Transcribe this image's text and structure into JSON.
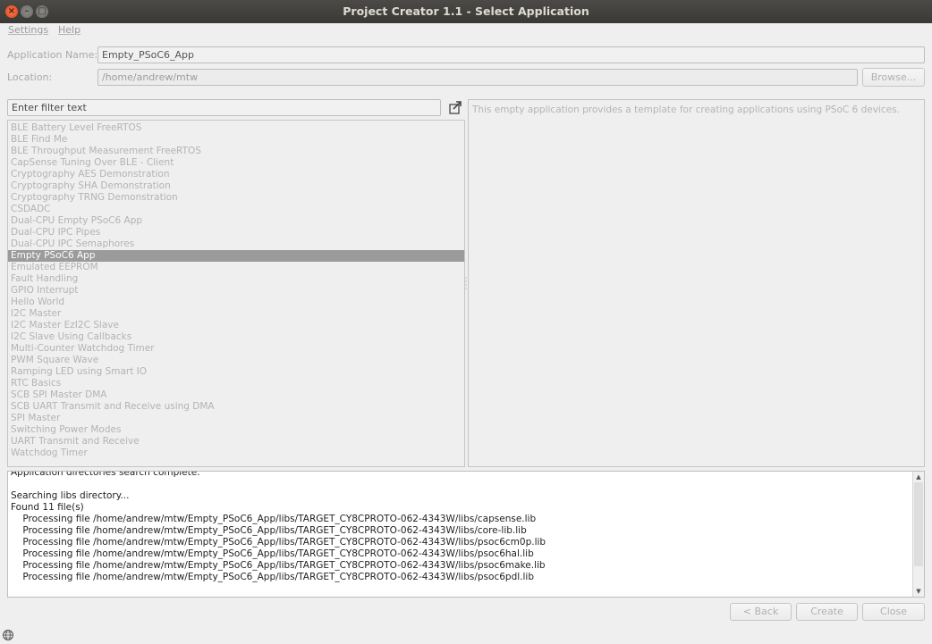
{
  "window": {
    "title": "Project Creator 1.1 - Select Application"
  },
  "menu": {
    "settings": "Settings",
    "help": "Help"
  },
  "form": {
    "app_name_label": "Application Name:",
    "app_name_value": "Empty_PSoC6_App",
    "location_label": "Location:",
    "location_value": "/home/andrew/mtw",
    "browse_label": "Browse..."
  },
  "filter": {
    "placeholder": "Enter filter text"
  },
  "apps": [
    {
      "label": "BLE Battery Level FreeRTOS",
      "selected": false
    },
    {
      "label": "BLE Find Me",
      "selected": false
    },
    {
      "label": "BLE Throughput Measurement FreeRTOS",
      "selected": false
    },
    {
      "label": "CapSense Tuning Over BLE - Client",
      "selected": false
    },
    {
      "label": "Cryptography AES Demonstration",
      "selected": false
    },
    {
      "label": "Cryptography SHA Demonstration",
      "selected": false
    },
    {
      "label": "Cryptography TRNG Demonstration",
      "selected": false
    },
    {
      "label": "CSDADC",
      "selected": false
    },
    {
      "label": "Dual-CPU Empty PSoC6 App",
      "selected": false
    },
    {
      "label": "Dual-CPU IPC Pipes",
      "selected": false
    },
    {
      "label": "Dual-CPU IPC Semaphores",
      "selected": false
    },
    {
      "label": "Empty PSoC6 App",
      "selected": true
    },
    {
      "label": "Emulated EEPROM",
      "selected": false
    },
    {
      "label": "Fault Handling",
      "selected": false
    },
    {
      "label": "GPIO Interrupt",
      "selected": false
    },
    {
      "label": "Hello World",
      "selected": false
    },
    {
      "label": "I2C Master",
      "selected": false
    },
    {
      "label": "I2C Master EzI2C Slave",
      "selected": false
    },
    {
      "label": "I2C Slave Using Callbacks",
      "selected": false
    },
    {
      "label": "Multi-Counter Watchdog Timer",
      "selected": false
    },
    {
      "label": "PWM Square Wave",
      "selected": false
    },
    {
      "label": "Ramping LED using Smart IO",
      "selected": false
    },
    {
      "label": "RTC Basics",
      "selected": false
    },
    {
      "label": "SCB SPI Master DMA",
      "selected": false
    },
    {
      "label": "SCB UART Transmit and Receive using DMA",
      "selected": false
    },
    {
      "label": "SPI Master",
      "selected": false
    },
    {
      "label": "Switching Power Modes",
      "selected": false
    },
    {
      "label": "UART Transmit and Receive",
      "selected": false
    },
    {
      "label": "Watchdog Timer",
      "selected": false
    }
  ],
  "description": "This empty application provides a template for creating applications using PSoC 6 devices.",
  "log": [
    "Application directories search complete.",
    "",
    "Searching libs directory...",
    "Found 11 file(s)",
    "    Processing file /home/andrew/mtw/Empty_PSoC6_App/libs/TARGET_CY8CPROTO-062-4343W/libs/capsense.lib",
    "    Processing file /home/andrew/mtw/Empty_PSoC6_App/libs/TARGET_CY8CPROTO-062-4343W/libs/core-lib.lib",
    "    Processing file /home/andrew/mtw/Empty_PSoC6_App/libs/TARGET_CY8CPROTO-062-4343W/libs/psoc6cm0p.lib",
    "    Processing file /home/andrew/mtw/Empty_PSoC6_App/libs/TARGET_CY8CPROTO-062-4343W/libs/psoc6hal.lib",
    "    Processing file /home/andrew/mtw/Empty_PSoC6_App/libs/TARGET_CY8CPROTO-062-4343W/libs/psoc6make.lib",
    "    Processing file /home/andrew/mtw/Empty_PSoC6_App/libs/TARGET_CY8CPROTO-062-4343W/libs/psoc6pdl.lib"
  ],
  "buttons": {
    "back": "< Back",
    "create": "Create",
    "close": "Close"
  },
  "icons": {
    "close": "close-icon",
    "minimize": "minimize-icon",
    "maximize": "maximize-icon",
    "filter_action": "export-icon",
    "status": "globe-icon"
  }
}
